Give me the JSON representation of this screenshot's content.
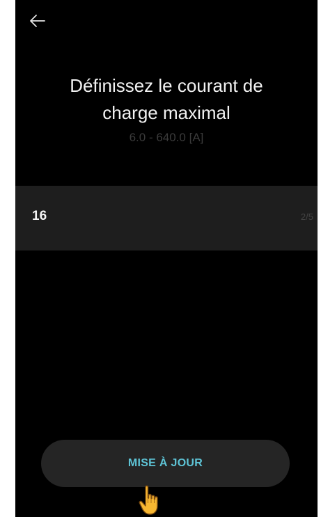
{
  "header": {
    "back_icon": "arrow-left-icon"
  },
  "title": {
    "line1": "Définissez le courant de",
    "line2": "charge maximal",
    "range": "6.0 - 640.0 [A]"
  },
  "input": {
    "value": "16",
    "counter": "2/5"
  },
  "action": {
    "update_label": "MISE À JOUR"
  },
  "overlay": {
    "cursor_icon": "pointing-hand-cursor-icon"
  },
  "colors": {
    "background": "#000000",
    "input_background": "#1e1e1e",
    "button_background": "#252525",
    "accent": "#5ec4d6"
  }
}
